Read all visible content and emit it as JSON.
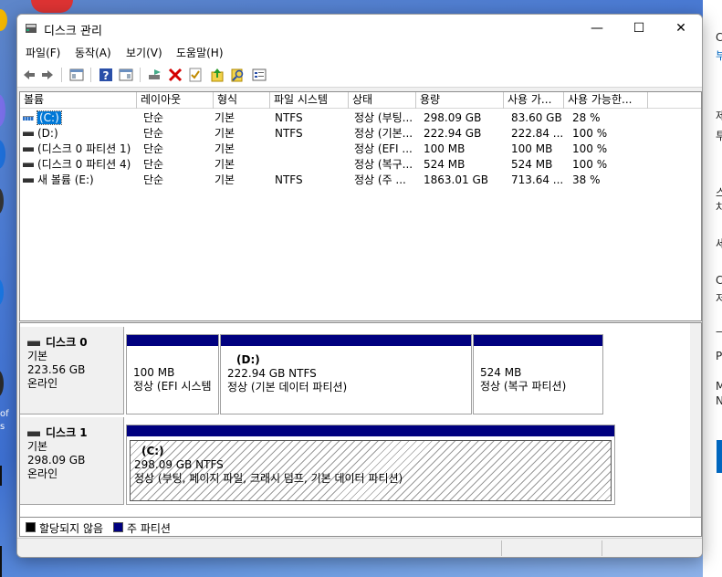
{
  "window": {
    "title": "디스크 관리",
    "controls": {
      "minimize": "—",
      "maximize": "☐",
      "close": "✕"
    }
  },
  "menu": [
    "파일(F)",
    "동작(A)",
    "보기(V)",
    "도움말(H)"
  ],
  "toolbar_icons": [
    "back-arrow-icon",
    "forward-arrow-icon",
    "show-hide-console-tree-icon",
    "help-icon",
    "properties-pane-icon",
    "connect-drive-icon",
    "delete-icon",
    "checkmark-icon",
    "export-icon",
    "search-icon",
    "properties-icon"
  ],
  "volume_table": {
    "columns": [
      "볼륨",
      "레이아웃",
      "형식",
      "파일 시스템",
      "상태",
      "용량",
      "사용 가...",
      "사용 가능한..."
    ],
    "rows": [
      {
        "volume": "(C:)",
        "layout": "단순",
        "type": "기본",
        "fs": "NTFS",
        "status": "정상 (부팅...",
        "capacity": "298.09 GB",
        "free": "83.60 GB",
        "pct": "28 %",
        "selected": true
      },
      {
        "volume": "(D:)",
        "layout": "단순",
        "type": "기본",
        "fs": "NTFS",
        "status": "정상 (기본...",
        "capacity": "222.94 GB",
        "free": "222.84 ...",
        "pct": "100 %",
        "selected": false
      },
      {
        "volume": "(디스크 0 파티션 1)",
        "layout": "단순",
        "type": "기본",
        "fs": "",
        "status": "정상 (EFI ...",
        "capacity": "100 MB",
        "free": "100 MB",
        "pct": "100 %",
        "selected": false
      },
      {
        "volume": "(디스크 0 파티션 4)",
        "layout": "단순",
        "type": "기본",
        "fs": "",
        "status": "정상 (복구...",
        "capacity": "524 MB",
        "free": "524 MB",
        "pct": "100 %",
        "selected": false
      },
      {
        "volume": "새 볼륨 (E:)",
        "layout": "단순",
        "type": "기본",
        "fs": "NTFS",
        "status": "정상 (주 ...",
        "capacity": "1863.01 GB",
        "free": "713.64 ...",
        "pct": "38 %",
        "selected": false
      }
    ]
  },
  "disks": [
    {
      "name": "디스크 0",
      "kind": "기본",
      "size": "223.56 GB",
      "state": "온라인",
      "partitions": [
        {
          "name": "",
          "line1": "100 MB",
          "line2": "정상 (EFI 시스템"
        },
        {
          "name": "(D:)",
          "line1": "222.94 GB NTFS",
          "line2": "정상 (기본 데이터 파티션)"
        },
        {
          "name": "",
          "line1": "524 MB",
          "line2": "정상 (복구 파티션)"
        }
      ]
    },
    {
      "name": "디스크 1",
      "kind": "기본",
      "size": "298.09 GB",
      "state": "온라인",
      "partitions": [
        {
          "name": "(C:)",
          "line1": "298.09 GB NTFS",
          "line2": "정상 (부팅, 페이지 파일, 크래시 덤프, 기본 데이터 파티션)"
        }
      ]
    }
  ],
  "legend": [
    {
      "label": "할당되지 않음",
      "color": "#000000"
    },
    {
      "label": "주 파티션",
      "color": "#00007f"
    }
  ],
  "background": {
    "left_fragments": [
      "of",
      "s"
    ],
    "right_fragments": [
      "C",
      "부",
      "제",
      "투",
      "스",
      "차",
      "세",
      "C",
      "저",
      "—",
      "P",
      "M",
      "N"
    ]
  }
}
